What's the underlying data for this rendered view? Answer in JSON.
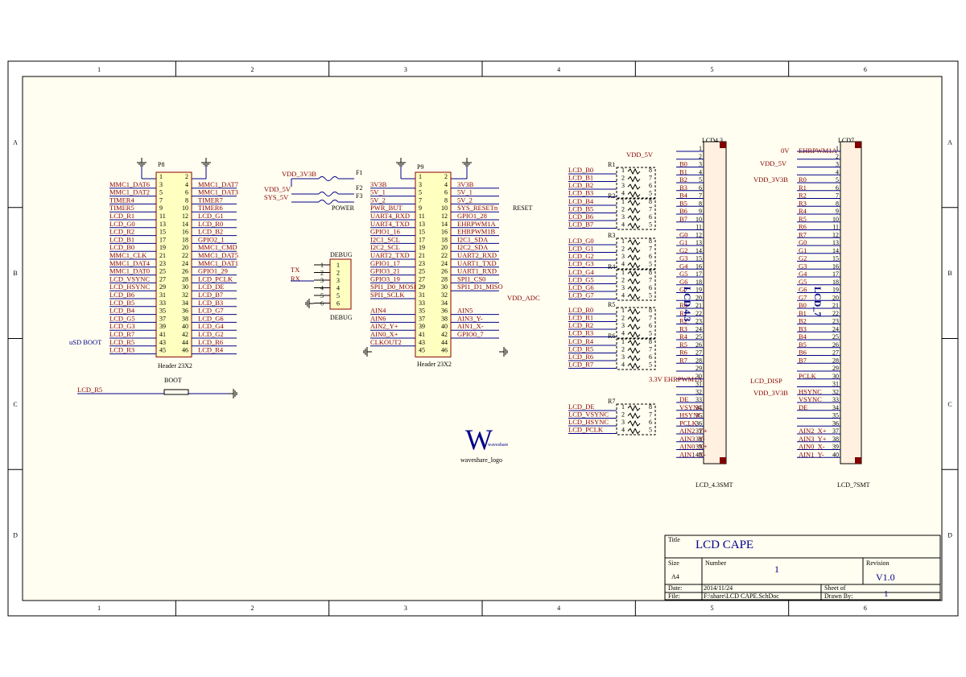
{
  "border": {
    "cols": [
      "1",
      "2",
      "3",
      "4",
      "5",
      "6"
    ],
    "rows": [
      "A",
      "B",
      "C",
      "D"
    ]
  },
  "p8": {
    "ref": "P8",
    "part": "Header 23X2",
    "extra": "uSD BOOT",
    "left": [
      "MMC1_DAT6",
      "MMC1_DAT2",
      "TIMER4",
      "TIMER5",
      "LCD_R1",
      "LCD_G0",
      "LCD_R2",
      "LCD_B1",
      "LCD_B0",
      "MMC1_CLK",
      "MMC1_DAT4",
      "MMC1_DAT0",
      "LCD_VSYNC",
      "LCD_HSYNC",
      "LCD_B6",
      "LCD_B5",
      "LCD_B4",
      "LCD_G5",
      "LCD_G3",
      "LCD_R7",
      "LCD_R5",
      "LCD_R3"
    ],
    "right": [
      "MMC1_DAT7",
      "MMC1_DAT3",
      "TIMER7",
      "TIMER6",
      "LCD_G1",
      "LCD_R0",
      "LCD_B2",
      "GPIO2_1",
      "MMC1_CMD",
      "MMC1_DAT5",
      "MMC1_DAT1",
      "GPIO1_29",
      "LCD_PCLK",
      "LCD_DE",
      "LCD_B7",
      "LCD_B3",
      "LCD_G7",
      "LCD_G6",
      "LCD_G4",
      "LCD_G2",
      "LCD_R6",
      "LCD_R4"
    ]
  },
  "p9": {
    "ref": "P9",
    "part": "Header 23X2",
    "vdd_adc": "VDD_ADC",
    "left": [
      "3V3B",
      "5V_1",
      "5V_2",
      "PWR_BUT",
      "UART4_RXD",
      "UART4_TXD",
      "GPIO1_16",
      "I2C1_SCL",
      "I2C2_SCL",
      "UART2_TXD",
      "GPIO1_17",
      "GPIO3_21",
      "GPIO3_19",
      "SPI1_D0_MOSI",
      "SPI1_SCLK",
      "",
      "AIN4",
      "AIN6",
      "AIN2_Y+",
      "AIN0_X+",
      "CLKOUT2"
    ],
    "right": [
      "3V3B",
      "5V_1",
      "5V_2",
      "SYS_RESETn",
      "GPIO1_28",
      "EHRPWM1A",
      "EHRPWM1B",
      "I2C1_SDA",
      "I2C2_SDA",
      "UART2_RXD",
      "UART1_TXD",
      "UART1_RXD",
      "SPI1_CS0",
      "SPI1_D1_MISO",
      "",
      "",
      "AIN5",
      "AIN3_Y-",
      "AIN1_X-",
      "GPIO0_7"
    ],
    "reset": "RESET"
  },
  "power": {
    "nets": [
      "VDD_3V3B",
      "VDD_5V",
      "SYS_5V"
    ],
    "fuses": [
      "F1",
      "F2",
      "F3"
    ],
    "label": "POWER"
  },
  "debug": {
    "title": "DEBUG",
    "tx": "TX",
    "rx": "RX",
    "pins": [
      "1",
      "2",
      "3",
      "4",
      "5",
      "6"
    ]
  },
  "boot": {
    "label": "BOOT",
    "net": "LCD_R5"
  },
  "logo": {
    "letter": "W",
    "small": "waveshare",
    "name": "waveshare_logo"
  },
  "rn": {
    "refs": [
      "R1",
      "R2",
      "R3",
      "R4",
      "R5",
      "R6",
      "R7"
    ],
    "groups": [
      [
        "LCD_B0",
        "LCD_B1",
        "LCD_B2",
        "LCD_B3"
      ],
      [
        "LCD_B4",
        "LCD_B5",
        "LCD_B6",
        "LCD_B7"
      ],
      [
        "LCD_G0",
        "LCD_G1",
        "LCD_G2",
        "LCD_G3"
      ],
      [
        "LCD_G4",
        "LCD_G5",
        "LCD_G6",
        "LCD_G7"
      ],
      [
        "LCD_R0",
        "LCD_R1",
        "LCD_R2",
        "LCD_R3"
      ],
      [
        "LCD_R4",
        "LCD_R5",
        "LCD_R6",
        "LCD_R7"
      ],
      [
        "LCD_DE",
        "LCD_VSYNC",
        "LCD_HSYNC",
        "LCD_PCLK"
      ]
    ]
  },
  "lcd43": {
    "ref": "LCD4.3",
    "name": "LCD 4.3",
    "foot": "LCD_4.3SMT",
    "vdd": "VDD_5V",
    "pwm": "3.3V EHRPWM1A",
    "nets": [
      "",
      "",
      "B0",
      "B1",
      "B2",
      "B3",
      "B4",
      "B5",
      "B6",
      "B7",
      "",
      "G0",
      "G1",
      "G2",
      "G3",
      "G4",
      "G5",
      "G6",
      "G7",
      "",
      "R0",
      "R1",
      "R2",
      "R3",
      "R4",
      "R5",
      "R6",
      "R7",
      "",
      "",
      "",
      "",
      "DE",
      "VSYNC",
      "HSYNC",
      "PCLK",
      "AIN2_Y+",
      "AIN3_Y-",
      "AIN0_X+",
      "AIN1_X-"
    ]
  },
  "lcd7": {
    "ref": "LCD7",
    "name": "LCD_7",
    "foot": "LCD_7SMT",
    "v0": "0V",
    "pwm": "EHRPWM1A",
    "vdd5": "VDD_5V",
    "vdd3": "VDD_3V3B",
    "disp": "LCD_DISP",
    "vdd3b": "VDD_3V3B",
    "nets": [
      "",
      "",
      "",
      "",
      "R0",
      "R1",
      "R2",
      "R3",
      "R4",
      "R5",
      "R6",
      "R7",
      "G0",
      "G1",
      "G2",
      "G3",
      "G4",
      "G5",
      "G6",
      "G7",
      "B0",
      "B1",
      "B2",
      "B3",
      "B4",
      "B5",
      "B6",
      "B7",
      "",
      "PCLK",
      "",
      "HSYNC",
      "VSYNC",
      "DE",
      "",
      "",
      "AIN2_X+",
      "AIN3_Y+",
      "AIN0_X-",
      "AIN1_Y-"
    ]
  },
  "title_block": {
    "title_lbl": "Title",
    "title": "LCD CAPE",
    "size_lbl": "Size",
    "size": "A4",
    "number_lbl": "Number",
    "number": "1",
    "rev_lbl": "Revision",
    "rev": "V1.0",
    "date_lbl": "Date:",
    "date": "2014/11/24",
    "sheet_lbl": "Sheet  of",
    "file_lbl": "File:",
    "file": "F:\\share\\LCD CAPE.SchDoc",
    "drawn_lbl": "Drawn By:",
    "sheet": "1"
  }
}
